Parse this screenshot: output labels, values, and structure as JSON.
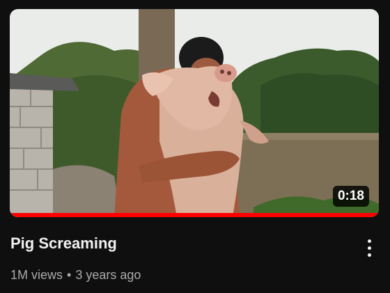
{
  "video": {
    "title": "Pig Screaming",
    "duration": "0:18",
    "views": "1M views",
    "separator": "•",
    "age": "3 years ago",
    "watch_progress": 1.0
  },
  "colors": {
    "background": "#0f0f0f",
    "progress": "#ff0000",
    "title_text": "#f1f1f1",
    "meta_text": "#aaaaaa"
  },
  "icons": {
    "menu": "more-vertical-icon"
  }
}
